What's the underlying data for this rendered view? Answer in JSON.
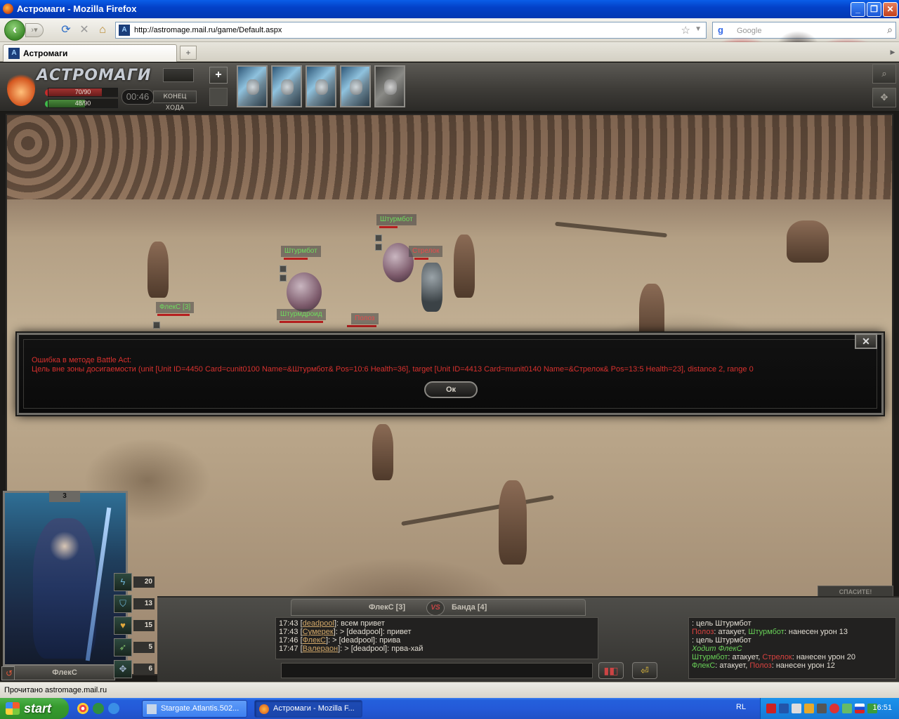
{
  "window": {
    "title": "Астромаги - Mozilla Firefox",
    "min": "_",
    "max": "❐",
    "close": "✕"
  },
  "navbar": {
    "url": "http://astromage.mail.ru/game/Default.aspx",
    "search_placeholder": "Google"
  },
  "tabs": [
    {
      "label": "Астромаги"
    }
  ],
  "game": {
    "logo_text": "АСТРОМАГИ",
    "hp": {
      "current": 70,
      "max": 90,
      "text": "70/90"
    },
    "mana": {
      "current": 48,
      "max": 90,
      "text": "48/90"
    },
    "timer": "00:46",
    "end_turn": "КОНЕЦ ХОДА",
    "plus": "+",
    "help_button": "СПАСИТЕ!"
  },
  "units": {
    "u1": "Штурмбот",
    "u2": "Штурмбот",
    "u3": "ФлекС [3]",
    "u4": "Штурмдроид",
    "u5": "Стрелок",
    "u6": "Полоз"
  },
  "dialog": {
    "title": "Ошибка в методе Battle Act:",
    "message": "Цель вне зоны досигаемости (unit [Unit ID=4450 Card=cunit0100 Name=&Штурмбот& Pos=10:6 Health=36], target [Unit ID=4413 Card=munit0140 Name=&Стрелок& Pos=13:5 Health=23], distance 2, range 0",
    "ok": "Ок",
    "close": "✕"
  },
  "hero": {
    "level": "3",
    "name": "ФлекС",
    "stats": [
      {
        "icon": "lightning-icon",
        "glyph": "ϟ",
        "value": "20"
      },
      {
        "icon": "shield-icon",
        "glyph": "⛉",
        "value": "13"
      },
      {
        "icon": "heart-icon",
        "glyph": "♥",
        "value": "15"
      },
      {
        "icon": "boots-icon",
        "glyph": "➶",
        "value": "5"
      },
      {
        "icon": "crosshair-icon",
        "glyph": "✥",
        "value": "6"
      }
    ]
  },
  "versus": {
    "p1": "ФлекС [3]",
    "vs": "VS",
    "p2": "Банда [4]"
  },
  "chat": [
    {
      "time": "17:43",
      "user": "deadpool",
      "text": ": всем привет"
    },
    {
      "time": "17:43",
      "user": "Сумерек",
      "text": ": > [deadpool]: привет"
    },
    {
      "time": "17:46",
      "user": "ФлекС",
      "text": ": > [deadpool]: прива"
    },
    {
      "time": "17:47",
      "user": "Валерaон",
      "text": ": > [deadpool]: прва-хай"
    }
  ],
  "combat_log": {
    "l1": ": цель Штурмбот",
    "l2a": "Полоз",
    "l2b": ": атакует, ",
    "l2c": "Штурмбот",
    "l2d": ": нанесен урон 13",
    "l3": ": цель Штурмбот",
    "l4": "Ходит ФлекС",
    "l5a": "Штурмбот",
    "l5b": ": атакует, ",
    "l5c": "Стрелок",
    "l5d": ": нанесен урон 20",
    "l6a": "ФлекС",
    "l6b": ": атакует, ",
    "l6c": "Полоз",
    "l6d": ": нанесен урон 12"
  },
  "status": "Прочитано astromage.mail.ru",
  "taskbar": {
    "start": "start",
    "tasks": [
      {
        "label": "Stargate.Atlantis.502..."
      },
      {
        "label": "Астромаги - Mozilla F..."
      }
    ],
    "lang": "RL",
    "clock": "16:51"
  }
}
